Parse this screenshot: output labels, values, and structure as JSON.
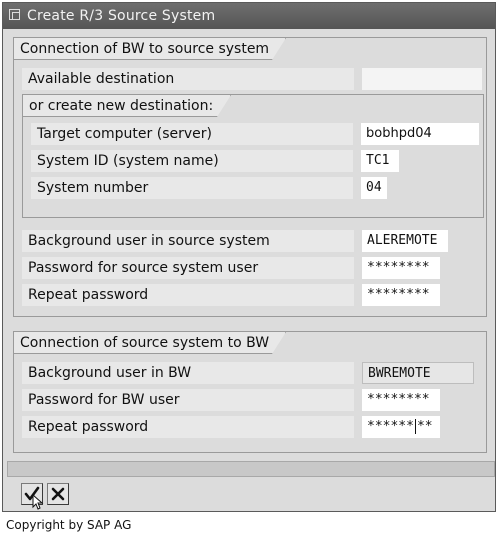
{
  "window": {
    "title": "Create R/3 Source System"
  },
  "group_bw_to_source": {
    "title": "Connection of BW to source system",
    "available_destination": {
      "label": "Available destination",
      "value": ""
    },
    "new_destination": {
      "title": "or create new destination:",
      "target_computer": {
        "label": "Target computer (server)",
        "value": "bobhpd04"
      },
      "system_id": {
        "label": "System ID (system name)",
        "value": "TC1"
      },
      "system_number": {
        "label": "System number",
        "value": "04"
      }
    },
    "background_user": {
      "label": "Background user in source system",
      "value": "ALEREMOTE"
    },
    "password": {
      "label": "Password for source system user",
      "value": "********"
    },
    "repeat_password": {
      "label": "Repeat password",
      "value": "********"
    }
  },
  "group_source_to_bw": {
    "title": "Connection of source system to BW",
    "background_user": {
      "label": "Background user in BW",
      "value": "BWREMOTE"
    },
    "password": {
      "label": "Password for BW user",
      "value": "********"
    },
    "repeat_password": {
      "label": "Repeat password",
      "value_before_cursor": "******",
      "value_after_cursor": "**"
    }
  },
  "toolbar": {
    "confirm_icon": "checkmark-icon",
    "cancel_icon": "cancel-x-icon"
  },
  "footer": {
    "copyright": "Copyright by SAP AG"
  }
}
